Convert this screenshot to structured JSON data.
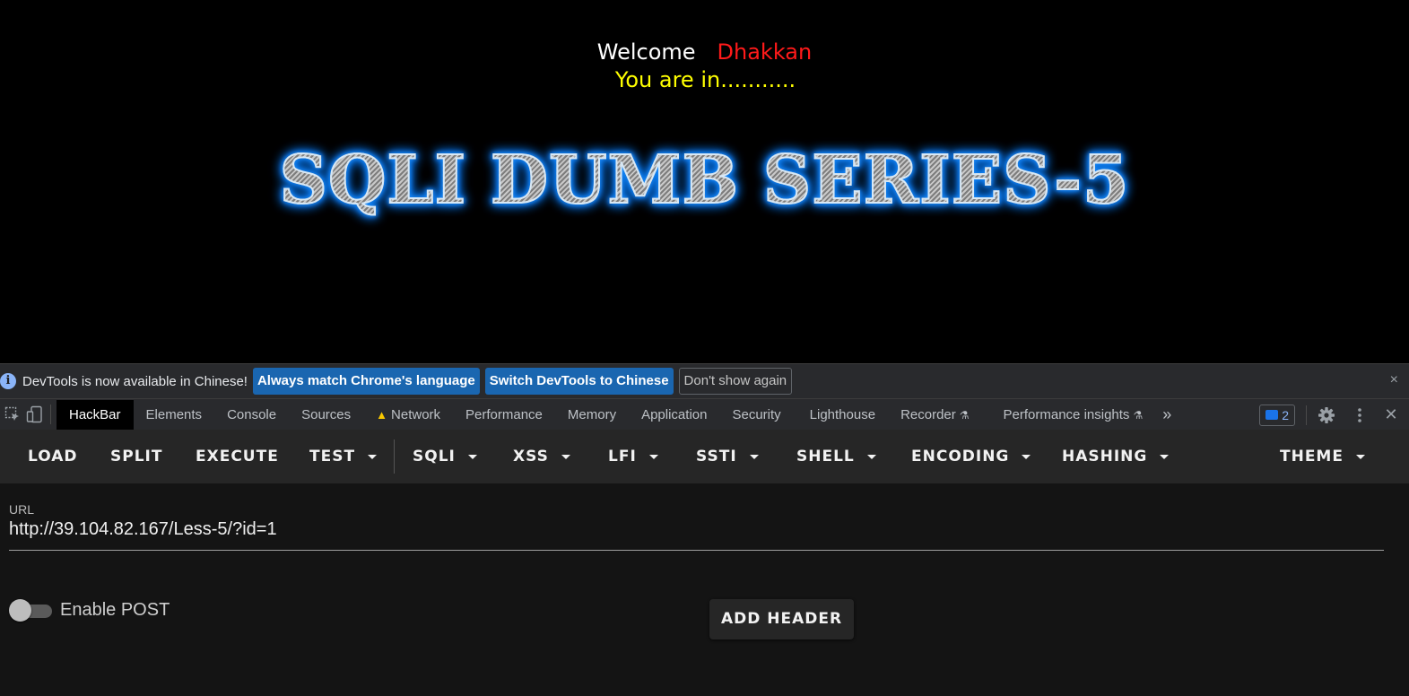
{
  "page": {
    "welcome": "Welcome",
    "username": "Dhakkan",
    "status": "You are in...........",
    "banner": "SQLI DUMB SERIES-5"
  },
  "infobar": {
    "message": "DevTools is now available in Chinese!",
    "btn_match": "Always match Chrome's language",
    "btn_switch": "Switch DevTools to Chinese",
    "btn_dismiss": "Don't show again",
    "close": "×"
  },
  "devtools": {
    "tabs": [
      "HackBar",
      "Elements",
      "Console",
      "Sources",
      "Network",
      "Performance",
      "Memory",
      "Application",
      "Security",
      "Lighthouse",
      "Recorder",
      "Performance insights"
    ],
    "more": "»",
    "issues_count": "2",
    "close": "✕"
  },
  "hackbar": {
    "buttons": [
      "LOAD",
      "SPLIT",
      "EXECUTE",
      "TEST",
      "SQLI",
      "XSS",
      "LFI",
      "SSTI",
      "SHELL",
      "ENCODING",
      "HASHING",
      "THEME"
    ],
    "url_label": "URL",
    "url_value": "http://39.104.82.167/Less-5/?id=1",
    "enable_post_label": "Enable POST",
    "enable_post": false,
    "add_header_label": "ADD HEADER"
  },
  "colors": {
    "username": "#ff1a1a",
    "status": "#ffff00",
    "primary_button": "#1a66b0",
    "issues_accent": "#8ab4f8"
  }
}
